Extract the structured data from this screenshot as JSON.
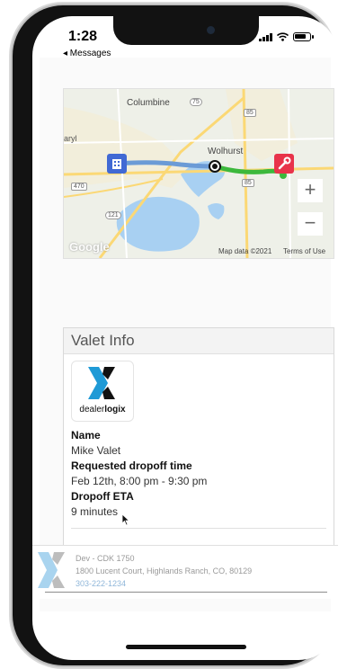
{
  "status_bar": {
    "time": "1:28",
    "back_label": "◂ Messages"
  },
  "map": {
    "labels": {
      "columbine": "Columbine",
      "wolhurst": "Wolhurst",
      "aryl": "aryl",
      "road_75": "75",
      "road_85_top": "85",
      "road_85_bottom": "85",
      "road_470": "470",
      "road_121": "121"
    },
    "google_logo": "Google",
    "attribution": "Map data ©2021",
    "terms": "Terms of Use",
    "zoom_in": "+",
    "zoom_out": "−",
    "colors": {
      "route_blue": "#6b9bd6",
      "route_green": "#3cb83c",
      "dealer_marker": "#e8334a",
      "home_marker": "#4169d4"
    }
  },
  "valet_card": {
    "title": "Valet Info",
    "logo_text": "dealer",
    "logo_text_bold": "logix",
    "name_label": "Name",
    "name_value": "Mike Valet",
    "dropoff_time_label": "Requested dropoff time",
    "dropoff_time_value": "Feb 12th, 8:00 pm - 9:30 pm",
    "eta_label": "Dropoff ETA",
    "eta_value": "9 minutes"
  },
  "footer": {
    "dealer_name": "Dev - CDK 1750",
    "address": "1800 Lucent Court, Highlands Ranch, CO, 80129",
    "phone": "303-222-1234"
  }
}
